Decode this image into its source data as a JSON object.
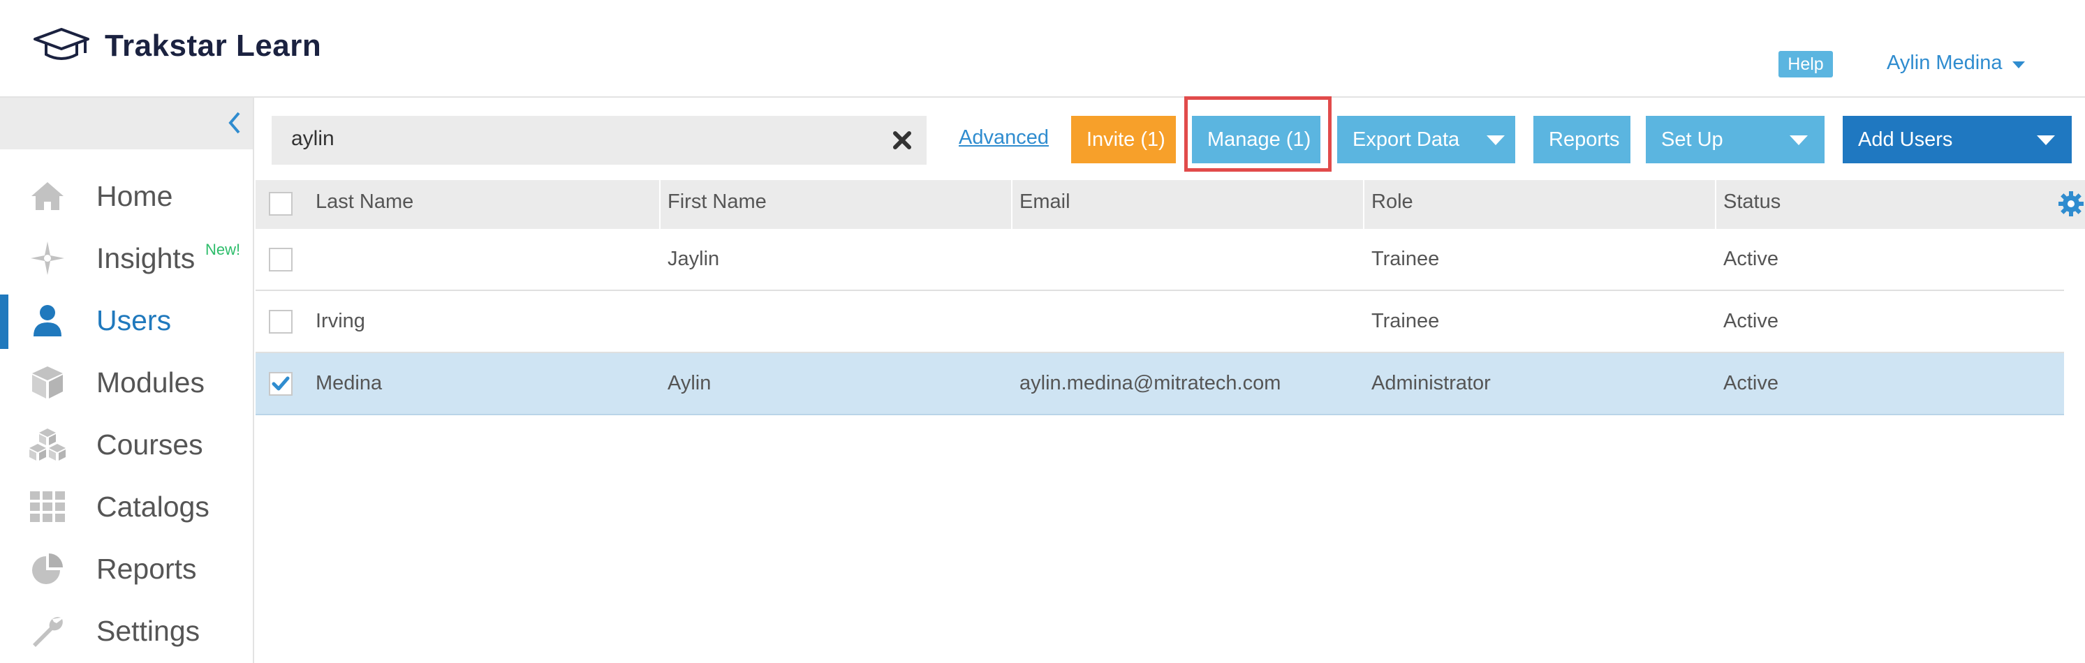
{
  "brand": {
    "name": "Trakstar Learn",
    "logo_icon": "graduation-cap-icon"
  },
  "header": {
    "help_label": "Help",
    "user_name": "Aylin Medina"
  },
  "sidebar": {
    "collapse_icon": "chevron-left-icon",
    "items": [
      {
        "label": "Home",
        "icon": "home-icon",
        "active": false
      },
      {
        "label": "Insights",
        "icon": "insights-icon",
        "active": false,
        "badge": "New!"
      },
      {
        "label": "Users",
        "icon": "user-icon",
        "active": true
      },
      {
        "label": "Modules",
        "icon": "cube-icon",
        "active": false
      },
      {
        "label": "Courses",
        "icon": "cubes-icon",
        "active": false
      },
      {
        "label": "Catalogs",
        "icon": "grid-icon",
        "active": false
      },
      {
        "label": "Reports",
        "icon": "pie-chart-icon",
        "active": false
      },
      {
        "label": "Settings",
        "icon": "wrench-icon",
        "active": false
      }
    ]
  },
  "toolbar": {
    "search_value": "aylin",
    "advanced_label": "Advanced",
    "invite_label": "Invite (1)",
    "manage_label": "Manage (1)",
    "export_label": "Export Data",
    "reports_label": "Reports",
    "setup_label": "Set Up",
    "add_users_label": "Add Users"
  },
  "table": {
    "columns": [
      "Last Name",
      "First Name",
      "Email",
      "Role",
      "Status"
    ],
    "rows": [
      {
        "last": "",
        "first": "Jaylin",
        "email": "",
        "role": "Trainee",
        "status": "Active",
        "checked": false
      },
      {
        "last": "Irving",
        "first": "",
        "email": "",
        "role": "Trainee",
        "status": "Active",
        "checked": false
      },
      {
        "last": "Medina",
        "first": "Aylin",
        "email": "aylin.medina@mitratech.com",
        "role": "Administrator",
        "status": "Active",
        "checked": true
      }
    ]
  },
  "colors": {
    "primary": "#1f78c1",
    "light_blue": "#5bb5e0",
    "orange": "#f7a02a",
    "highlight": "#e14b4b",
    "selected_row": "#cfe4f3"
  }
}
